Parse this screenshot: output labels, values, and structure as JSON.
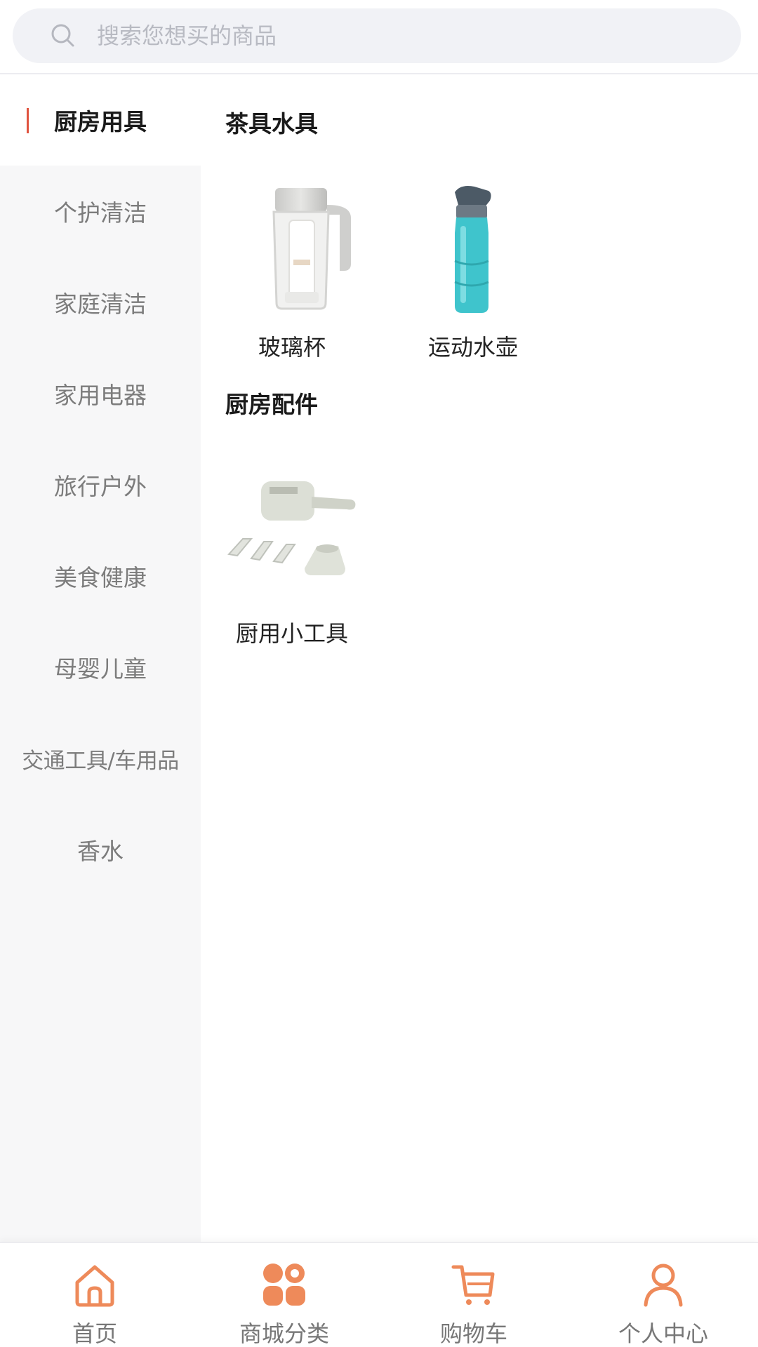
{
  "search": {
    "placeholder": "搜索您想买的商品"
  },
  "sidebar": {
    "items": [
      {
        "label": "厨房用具",
        "active": true
      },
      {
        "label": "个护清洁"
      },
      {
        "label": "家庭清洁"
      },
      {
        "label": "家用电器"
      },
      {
        "label": "旅行户外"
      },
      {
        "label": "美食健康"
      },
      {
        "label": "母婴儿童"
      },
      {
        "label": "交通工具/车用品"
      },
      {
        "label": "香水"
      }
    ]
  },
  "content": {
    "groups": [
      {
        "title": "茶具水具",
        "products": [
          {
            "name": "玻璃杯",
            "icon": "glass-cup"
          },
          {
            "name": "运动水壶",
            "icon": "sport-bottle"
          }
        ]
      },
      {
        "title": "厨房配件",
        "products": [
          {
            "name": "厨用小工具",
            "icon": "kitchen-grater"
          }
        ]
      }
    ]
  },
  "tabbar": {
    "accent": "#ee8a5a",
    "tabs": [
      {
        "label": "首页",
        "icon": "home-icon"
      },
      {
        "label": "商城分类",
        "icon": "category-icon",
        "active": true
      },
      {
        "label": "购物车",
        "icon": "cart-icon"
      },
      {
        "label": "个人中心",
        "icon": "user-icon"
      }
    ]
  },
  "colors": {
    "active_marker": "#e0533f",
    "sidebar_bg": "#f7f7f8"
  }
}
